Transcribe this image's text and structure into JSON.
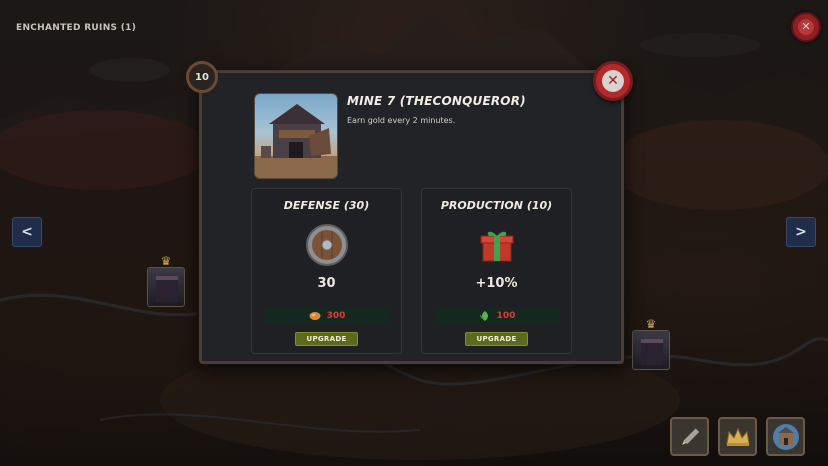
{
  "region": {
    "title": "ENCHANTED RUINS (1)"
  },
  "icons": {
    "top_close": "close-icon",
    "prev": "arrow-left-icon",
    "next": "arrow-right-icon",
    "dialog_close": "close-icon",
    "defense": "shield-icon",
    "production": "gift-icon",
    "defense_cost": "ore-icon",
    "production_cost": "leaf-icon",
    "edit": "pencil-icon",
    "crown": "crown-icon",
    "castle": "castle-icon"
  },
  "navigation": {
    "prev_label": "<",
    "next_label": ">"
  },
  "dialog": {
    "level": "10",
    "building_name": "MINE 7 (THECONQUEROR)",
    "building_description": "Earn gold every 2 minutes.",
    "defense": {
      "title": "DEFENSE (30)",
      "value": "30",
      "cost": "300",
      "upgrade_label": "UPGRADE"
    },
    "production": {
      "title": "PRODUCTION (10)",
      "value": "+10%",
      "cost": "100",
      "upgrade_label": "UPGRADE"
    }
  },
  "colors": {
    "cost_red": "#e0393d",
    "upgrade_green": "#5c6a1e",
    "close_red": "#b32a2d",
    "nav_blue": "#1f2c4a"
  }
}
